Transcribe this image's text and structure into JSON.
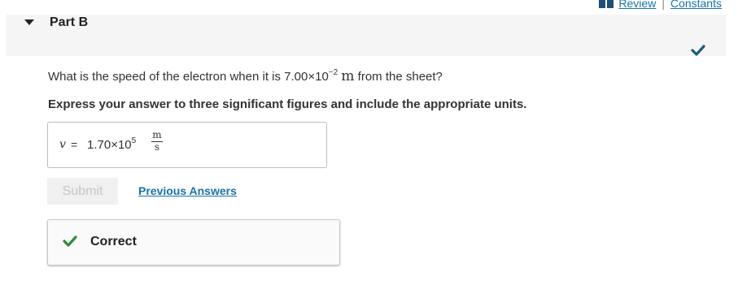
{
  "topbar": {
    "icon": "book-icon",
    "review_label": "Review",
    "separator": "|",
    "constants_label": "Constants"
  },
  "part": {
    "title": "Part B",
    "status_icon": "checkmark-icon"
  },
  "question": {
    "text_before": "What is the speed of the electron when it is 7.00×10",
    "exponent": "−2",
    "unit": "m",
    "text_after": " from the sheet?"
  },
  "instruction": "Express your answer to three significant figures and include the appropriate units.",
  "answer": {
    "variable": "v",
    "equals": "=",
    "mantissa": "1.70×10",
    "exponent": "5",
    "unit_numerator": "m",
    "unit_denominator": "s"
  },
  "actions": {
    "submit_label": "Submit",
    "previous_answers_label": "Previous Answers"
  },
  "result": {
    "icon": "checkmark-icon",
    "text": "Correct"
  },
  "colors": {
    "link": "#1a73a8",
    "success": "#2a8a3e",
    "header_bg": "#f5f5f5"
  }
}
